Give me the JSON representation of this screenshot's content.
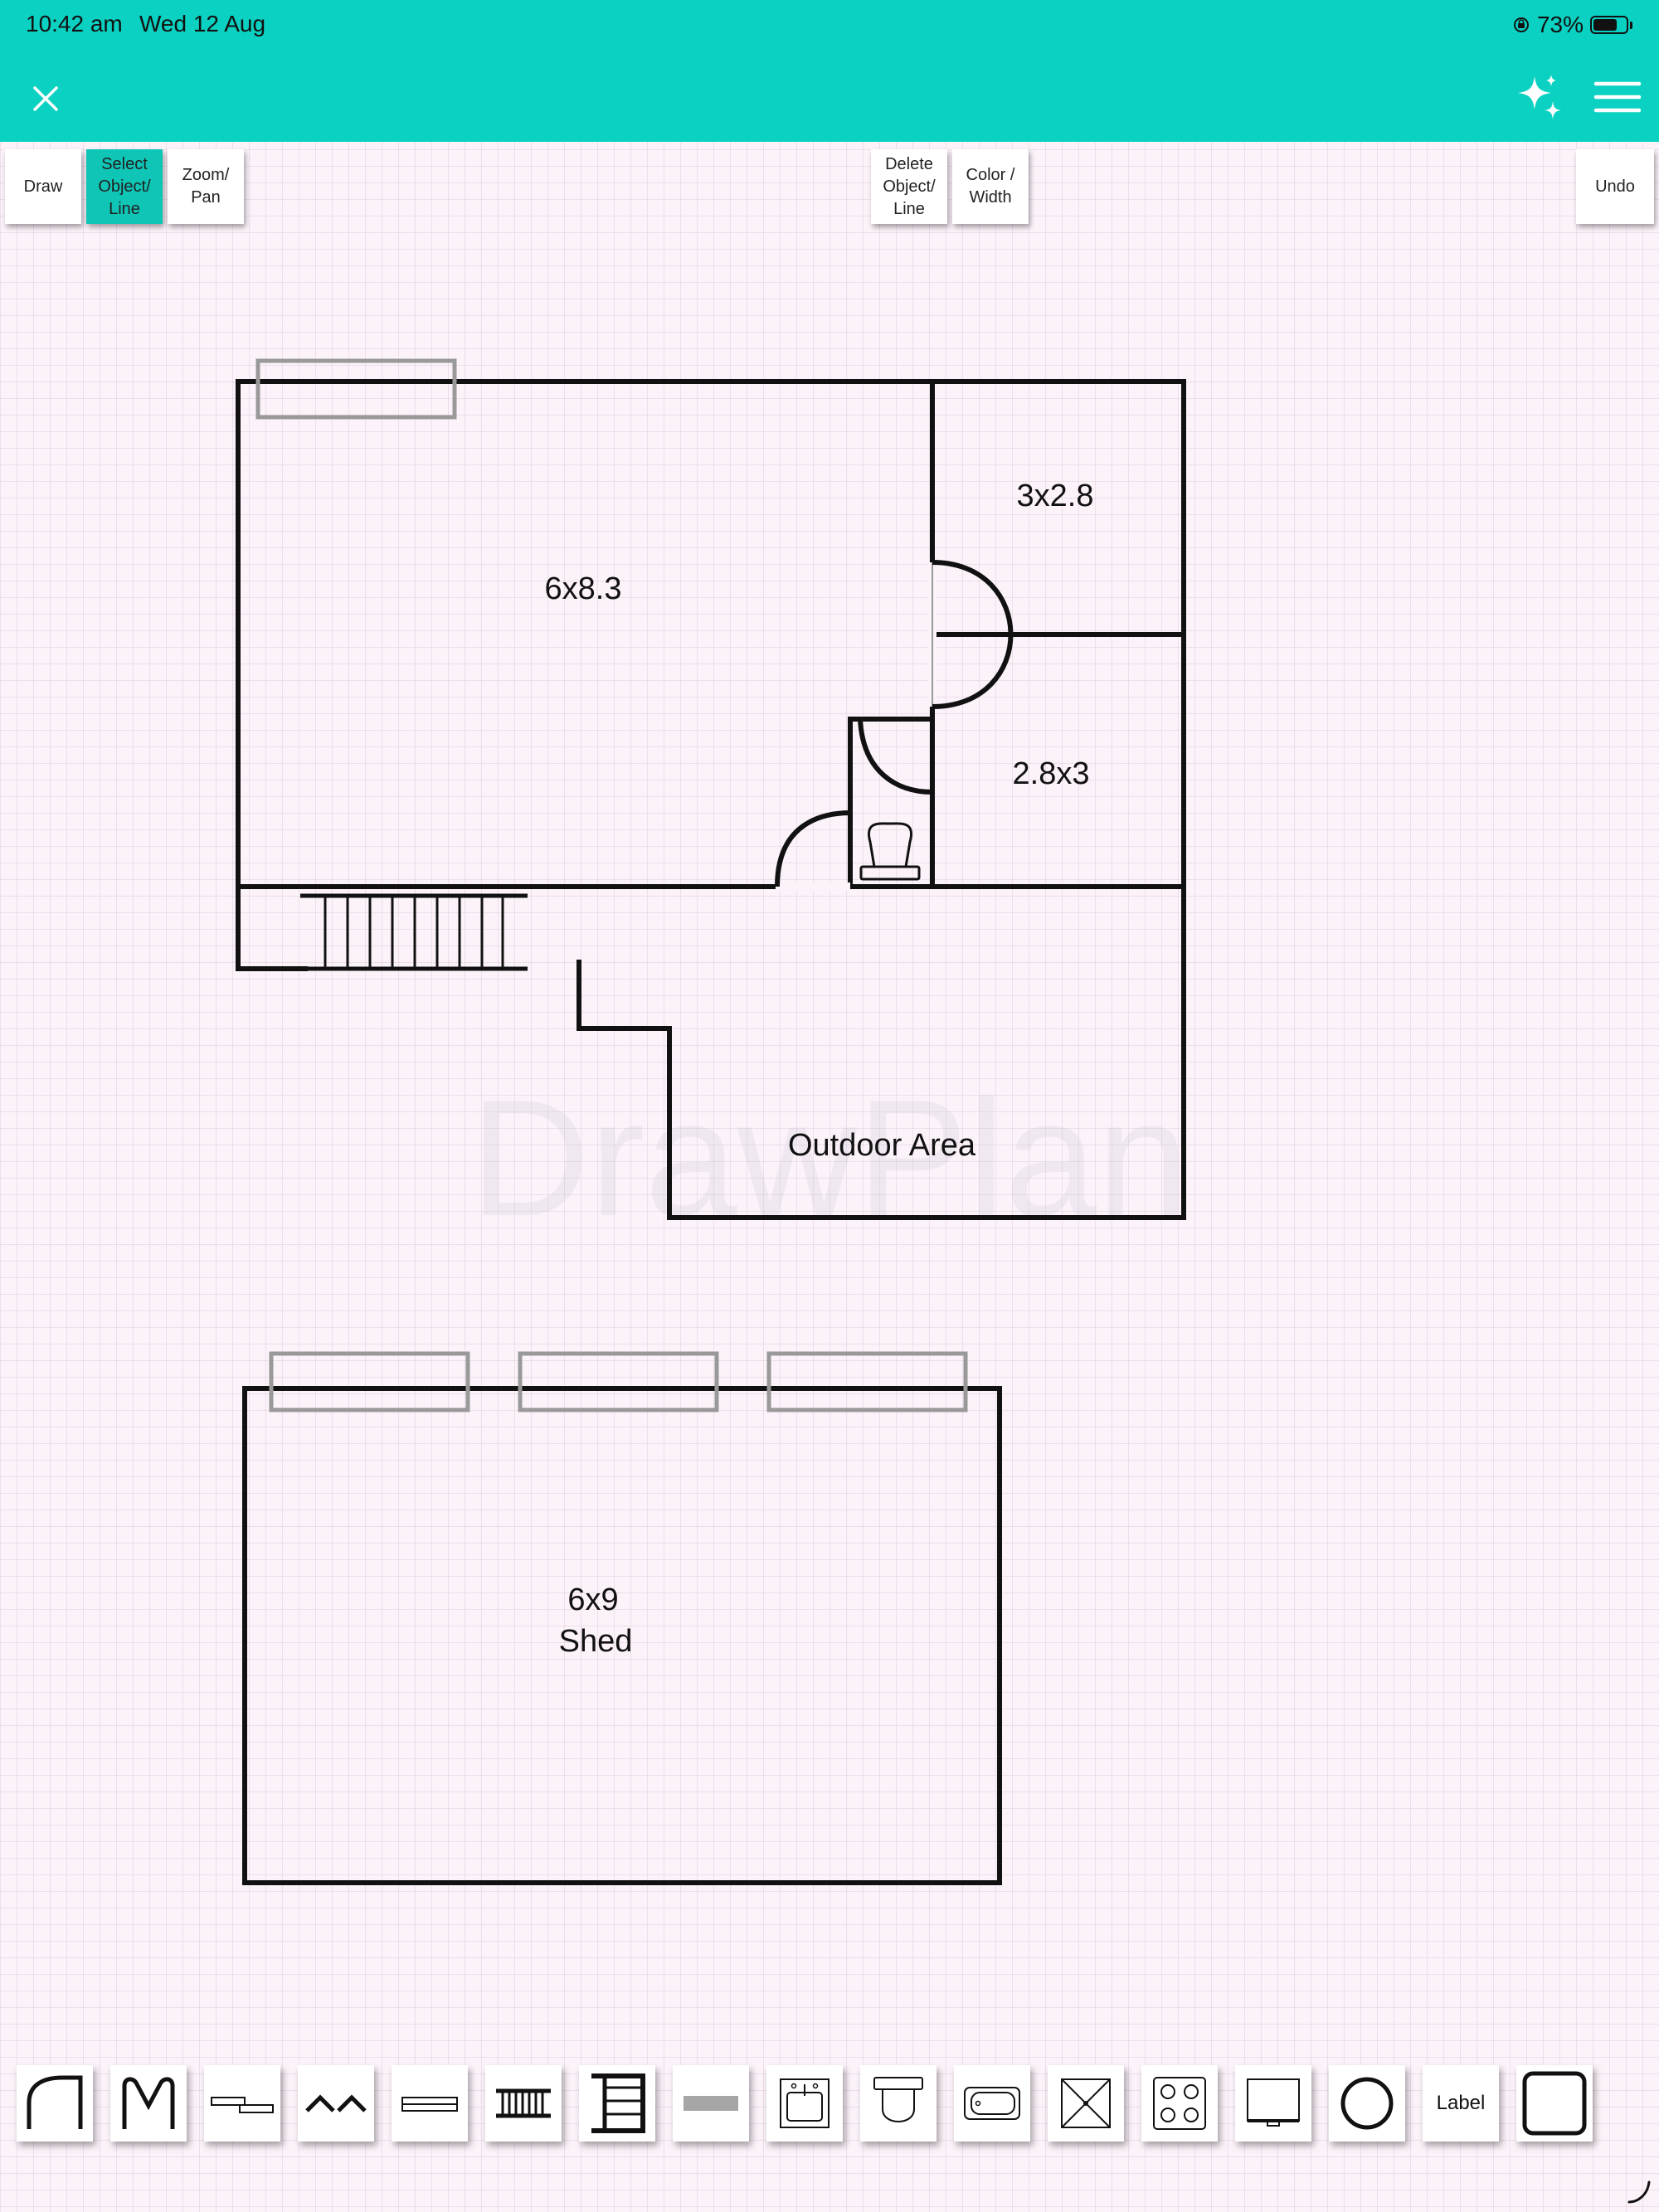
{
  "status_bar": {
    "time": "10:42 am",
    "date": "Wed 12 Aug",
    "battery_pct": "73%",
    "battery_level": 0.73
  },
  "header": {
    "background": "#0ad1c1",
    "close_icon": "close-icon",
    "magic_icon": "sparkles-icon",
    "menu_icon": "hamburger-menu-icon"
  },
  "toolbar": {
    "active_color": "#0ec5b6",
    "draw": "Draw",
    "select": "Select\nObject/\nLine",
    "zoom_pan": "Zoom/\nPan",
    "delete": "Delete\nObject/\nLine",
    "color_width": "Color /\nWidth",
    "undo": "Undo"
  },
  "canvas": {
    "watermark": "DrawPlan",
    "labels": {
      "room_main": "6x8.3",
      "room_upper_right": "3x2.8",
      "room_lower_right": "2.8x3",
      "outdoor": "Outdoor Area",
      "shed_size": "6x9",
      "shed_name": "Shed"
    }
  },
  "palette": {
    "items": [
      "door-icon",
      "double-door-icon",
      "sliding-door-icon",
      "bifold-door-icon",
      "window-icon",
      "stairs-icon",
      "staircase-icon",
      "wall-block-icon",
      "sink-icon",
      "toilet-icon",
      "bathtub-icon",
      "shower-icon",
      "stove-icon",
      "tv-icon",
      "circle-icon",
      "label-icon",
      "rectangle-icon"
    ],
    "label_text": "Label"
  }
}
